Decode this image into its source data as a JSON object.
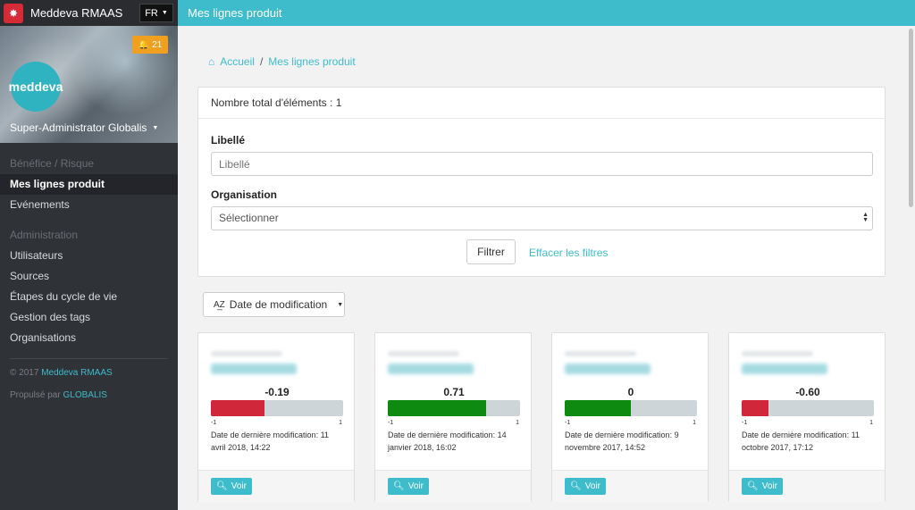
{
  "topbar": {
    "app_name": "Meddeva RMAAS",
    "lang": "FR",
    "page_title": "Mes lignes produit",
    "accent": "#3ebccb"
  },
  "sidebar": {
    "avatar_text": "meddeva",
    "notifications": "21",
    "username": "Super-Administrator Globalis",
    "sections": [
      {
        "title": "Bénéfice / Risque",
        "items": [
          "Mes lignes produit",
          "Evénements"
        ]
      },
      {
        "title": "Administration",
        "items": [
          "Utilisateurs",
          "Sources",
          "Étapes du cycle de vie",
          "Gestion des tags",
          "Organisations"
        ]
      }
    ],
    "footer": {
      "copyright_prefix": "© 2017",
      "copyright_link": "Meddeva RMAAS",
      "powered_prefix": "Propulsé par",
      "powered_link": "GLOBALIS"
    }
  },
  "breadcrumb": {
    "home": "Accueil",
    "current": "Mes lignes produit"
  },
  "filter_panel": {
    "total": "Nombre total d'éléments : 1",
    "label_field": {
      "label": "Libellé",
      "placeholder": "Libellé"
    },
    "org_field": {
      "label": "Organisation",
      "value": "Sélectionner"
    },
    "filter_button": "Filtrer",
    "clear_link": "Effacer les filtres"
  },
  "sort": {
    "icon": "sort-alpha-icon",
    "label": "Date de modification"
  },
  "cards": [
    {
      "score": "-0.19",
      "score_value": -0.19,
      "fill_color": "#d0283a",
      "fill_fraction": 0.405,
      "range_min": "-1",
      "range_max": "1",
      "date": "Date de dernière modification: 11 avril 2018, 14:22",
      "button": "Voir"
    },
    {
      "score": "0.71",
      "score_value": 0.71,
      "fill_color": "#0f8a10",
      "fill_fraction": 0.745,
      "range_min": "-1",
      "range_max": "1",
      "date": "Date de dernière modification: 14 janvier 2018, 16:02",
      "button": "Voir"
    },
    {
      "score": "0",
      "score_value": 0,
      "fill_color": "#0f8a10",
      "fill_fraction": 0.5,
      "range_min": "-1",
      "range_max": "1",
      "date": "Date de dernière modification: 9 novembre 2017, 14:52",
      "button": "Voir"
    },
    {
      "score": "-0.60",
      "score_value": -0.6,
      "fill_color": "#d0283a",
      "fill_fraction": 0.2,
      "range_min": "-1",
      "range_max": "1",
      "date": "Date de dernière modification: 11 octobre 2017, 17:12",
      "button": "Voir"
    }
  ]
}
